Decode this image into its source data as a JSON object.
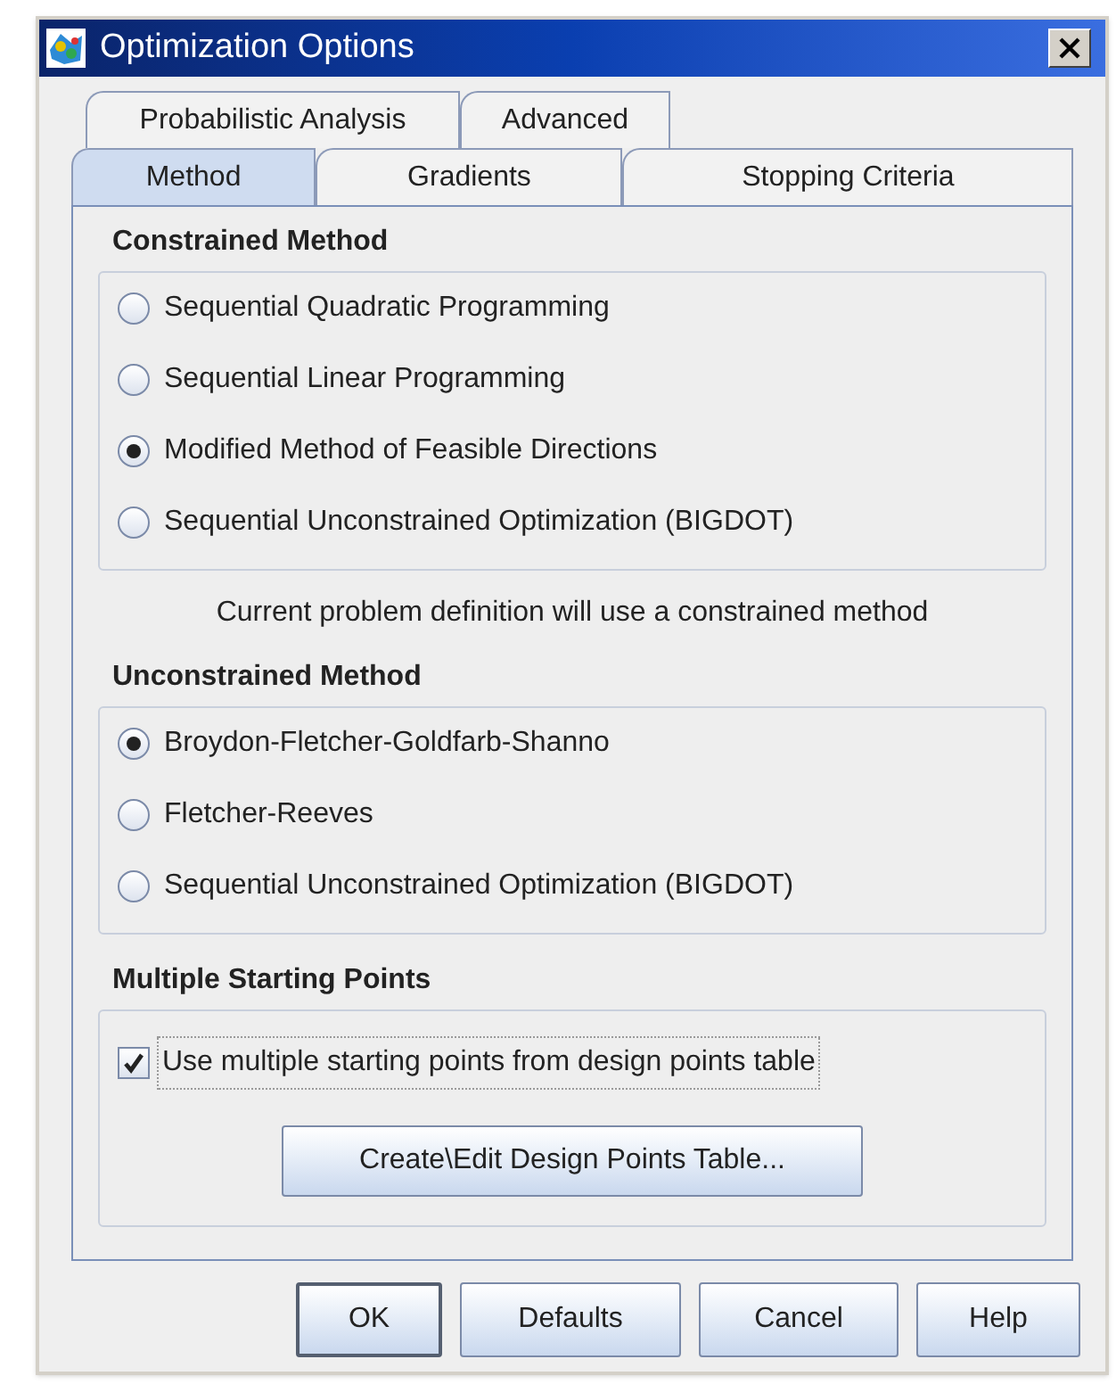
{
  "window": {
    "title": "Optimization Options"
  },
  "tab_rows": [
    [
      {
        "label": "Probabilistic Analysis",
        "selected": false
      },
      {
        "label": "Advanced",
        "selected": false
      }
    ],
    [
      {
        "label": "Method",
        "selected": true
      },
      {
        "label": "Gradients",
        "selected": false
      },
      {
        "label": "Stopping Criteria",
        "selected": false
      }
    ]
  ],
  "constrained_method": {
    "title": "Constrained Method",
    "options": [
      {
        "label": "Sequential Quadratic Programming",
        "selected": false
      },
      {
        "label": "Sequential Linear Programming",
        "selected": false
      },
      {
        "label": "Modified Method of Feasible Directions",
        "selected": true
      },
      {
        "label": "Sequential Unconstrained Optimization (BIGDOT)",
        "selected": false
      }
    ]
  },
  "note": "Current problem definition will use a constrained method",
  "unconstrained_method": {
    "title": "Unconstrained Method",
    "options": [
      {
        "label": "Broydon-Fletcher-Goldfarb-Shanno",
        "selected": true
      },
      {
        "label": "Fletcher-Reeves",
        "selected": false
      },
      {
        "label": "Sequential Unconstrained Optimization (BIGDOT)",
        "selected": false
      }
    ]
  },
  "multiple_starting_points": {
    "title": "Multiple Starting Points",
    "checkbox": {
      "label": "Use multiple starting points from design points table",
      "checked": true
    },
    "button": "Create\\Edit Design Points Table..."
  },
  "buttons": [
    {
      "label": "OK",
      "default": true
    },
    {
      "label": "Defaults",
      "default": false
    },
    {
      "label": "Cancel",
      "default": false
    },
    {
      "label": "Help",
      "default": false
    }
  ]
}
